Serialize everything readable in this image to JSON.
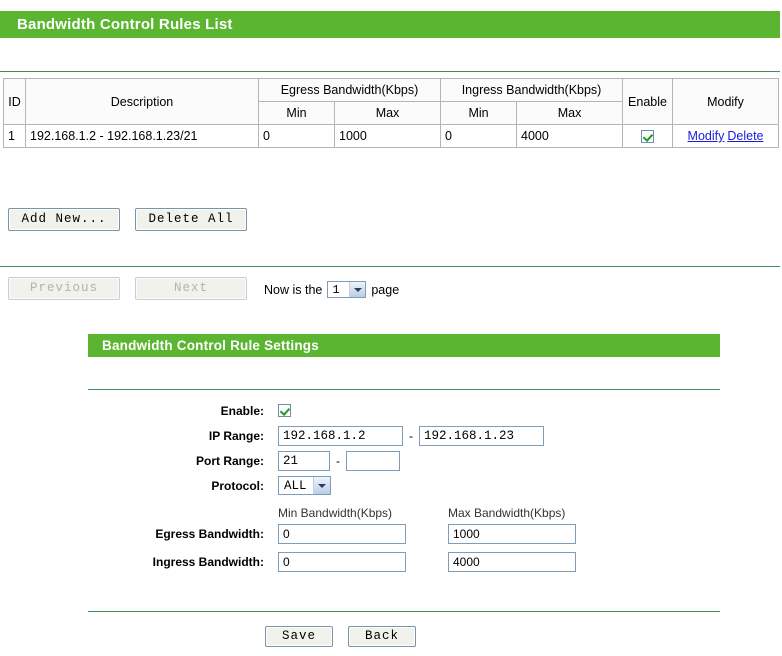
{
  "rules_section": {
    "title": "Bandwidth Control Rules List",
    "table": {
      "headers": {
        "id": "ID",
        "description": "Description",
        "egress": "Egress Bandwidth(Kbps)",
        "ingress": "Ingress Bandwidth(Kbps)",
        "enable": "Enable",
        "modify": "Modify",
        "min": "Min",
        "max": "Max"
      },
      "rows": [
        {
          "id": "1",
          "description": "192.168.1.2 - 192.168.1.23/21",
          "egress_min": "0",
          "egress_max": "1000",
          "ingress_min": "0",
          "ingress_max": "4000",
          "enabled": true,
          "modify_label": "Modify",
          "delete_label": "Delete"
        }
      ]
    },
    "buttons": {
      "add_new": "Add New...",
      "delete_all": "Delete All",
      "previous": "Previous",
      "next": "Next"
    },
    "pagination": {
      "prefix": "Now is the",
      "current_page": "1",
      "suffix": "page"
    }
  },
  "settings_section": {
    "title": "Bandwidth Control Rule Settings",
    "labels": {
      "enable": "Enable:",
      "ip_range": "IP Range:",
      "port_range": "Port Range:",
      "protocol": "Protocol:",
      "min_bandwidth": "Min Bandwidth(Kbps)",
      "max_bandwidth": "Max Bandwidth(Kbps)",
      "egress_bandwidth": "Egress Bandwidth:",
      "ingress_bandwidth": "Ingress Bandwidth:"
    },
    "values": {
      "enable_checked": true,
      "ip_start": "192.168.1.2",
      "ip_end": "192.168.1.23",
      "port_start": "21",
      "port_end": "",
      "protocol": "ALL",
      "egress_min": "0",
      "egress_max": "1000",
      "ingress_min": "0",
      "ingress_max": "4000",
      "range_separator": "-"
    },
    "buttons": {
      "save": "Save",
      "back": "Back"
    }
  },
  "colors": {
    "header_green": "#5cb531",
    "rule_line_green": "#3f8f56",
    "link_blue": "#1b1bdc",
    "check_green": "#1f9a27"
  }
}
